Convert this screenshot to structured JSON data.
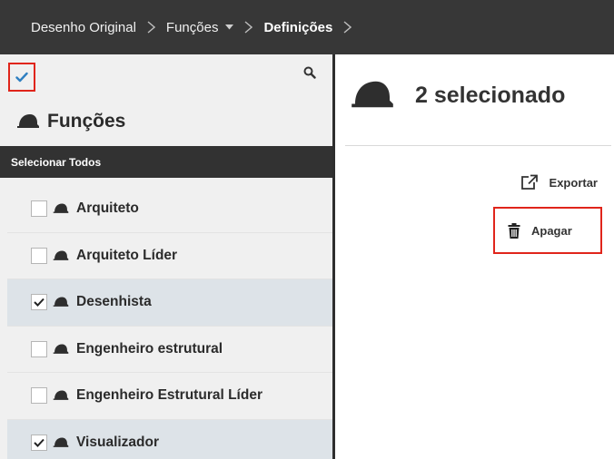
{
  "breadcrumb": {
    "items": [
      "Desenho Original",
      "Funções",
      "Definições"
    ],
    "separator": ">"
  },
  "left_panel": {
    "title": "Funções",
    "select_all_label": "Selecionar Todos",
    "items": [
      {
        "label": "Arquiteto",
        "checked": false
      },
      {
        "label": "Arquiteto Líder",
        "checked": false
      },
      {
        "label": "Desenhista",
        "checked": true
      },
      {
        "label": "Engenheiro estrutural",
        "checked": false
      },
      {
        "label": "Engenheiro Estrutural Líder",
        "checked": false
      },
      {
        "label": "Visualizador",
        "checked": true
      }
    ]
  },
  "right_panel": {
    "heading": "2 selecionado",
    "actions": {
      "export_label": "Exportar",
      "delete_label": "Apagar"
    }
  },
  "icons": {
    "role": "hard-hat-icon",
    "check": "checkmark-icon",
    "search": "search-icon",
    "export": "export-icon",
    "delete": "trash-icon",
    "dropdown": "caret-down-icon",
    "separator": "chevron-right-icon"
  },
  "colors": {
    "topbar": "#373737",
    "highlight": "#e0251b",
    "checked_row": "#dde3e8",
    "accent_check": "#2f7fc1"
  }
}
